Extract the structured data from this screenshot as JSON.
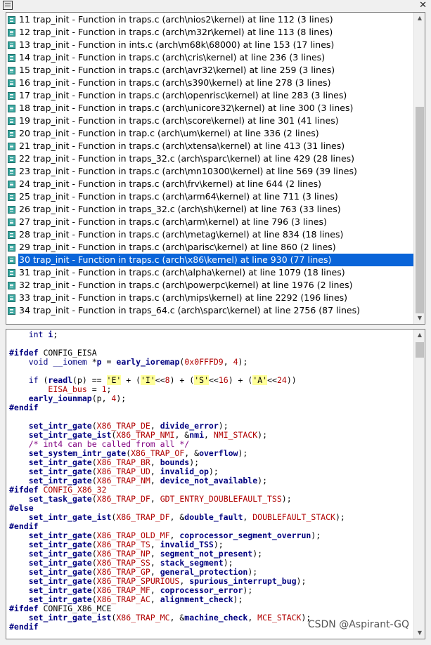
{
  "window": {
    "close_glyph": "✕"
  },
  "results": [
    {
      "label": "11 trap_init - Function in traps.c (arch\\nios2\\kernel) at line 112 (3 lines)"
    },
    {
      "label": "12 trap_init - Function in traps.c (arch\\m32r\\kernel) at line 113 (8 lines)"
    },
    {
      "label": "13 trap_init - Function in ints.c (arch\\m68k\\68000) at line 153 (17 lines)"
    },
    {
      "label": "14 trap_init - Function in traps.c (arch\\cris\\kernel) at line 236 (3 lines)"
    },
    {
      "label": "15 trap_init - Function in traps.c (arch\\avr32\\kernel) at line 259 (3 lines)"
    },
    {
      "label": "16 trap_init - Function in traps.c (arch\\s390\\kernel) at line 278 (3 lines)"
    },
    {
      "label": "17 trap_init - Function in traps.c (arch\\openrisc\\kernel) at line 283 (3 lines)"
    },
    {
      "label": "18 trap_init - Function in traps.c (arch\\unicore32\\kernel) at line 300 (3 lines)"
    },
    {
      "label": "19 trap_init - Function in traps.c (arch\\score\\kernel) at line 301 (41 lines)"
    },
    {
      "label": "20 trap_init - Function in trap.c (arch\\um\\kernel) at line 336 (2 lines)"
    },
    {
      "label": "21 trap_init - Function in traps.c (arch\\xtensa\\kernel) at line 413 (31 lines)"
    },
    {
      "label": "22 trap_init - Function in traps_32.c (arch\\sparc\\kernel) at line 429 (28 lines)"
    },
    {
      "label": "23 trap_init - Function in traps.c (arch\\mn10300\\kernel) at line 569 (39 lines)"
    },
    {
      "label": "24 trap_init - Function in traps.c (arch\\frv\\kernel) at line 644 (2 lines)"
    },
    {
      "label": "25 trap_init - Function in traps.c (arch\\arm64\\kernel) at line 711 (3 lines)"
    },
    {
      "label": "26 trap_init - Function in traps_32.c (arch\\sh\\kernel) at line 763 (33 lines)"
    },
    {
      "label": "27 trap_init - Function in traps.c (arch\\arm\\kernel) at line 796 (3 lines)"
    },
    {
      "label": "28 trap_init - Function in traps.c (arch\\metag\\kernel) at line 834 (18 lines)"
    },
    {
      "label": "29 trap_init - Function in traps.c (arch\\parisc\\kernel) at line 860 (2 lines)"
    },
    {
      "label": "30 trap_init - Function in traps.c (arch\\x86\\kernel) at line 930 (77 lines)",
      "selected": true
    },
    {
      "label": "31 trap_init - Function in traps.c (arch\\alpha\\kernel) at line 1079 (18 lines)"
    },
    {
      "label": "32 trap_init - Function in traps.c (arch\\powerpc\\kernel) at line 1976 (2 lines)"
    },
    {
      "label": "33 trap_init - Function in traps.c (arch\\mips\\kernel) at line 2292 (196 lines)"
    },
    {
      "label": "34 trap_init - Function in traps_64.c (arch\\sparc\\kernel) at line 2756 (87 lines)"
    }
  ],
  "code_lines": [
    [
      [
        "    ",
        ""
      ],
      [
        "int",
        "kw"
      ],
      [
        " ",
        ""
      ],
      [
        "i",
        "fn"
      ],
      [
        ";",
        ""
      ]
    ],
    [],
    [
      [
        "#ifdef",
        "pp"
      ],
      [
        " CONFIG_EISA",
        ""
      ]
    ],
    [
      [
        "    ",
        ""
      ],
      [
        "void",
        "kw"
      ],
      [
        " ",
        ""
      ],
      [
        "__iomem",
        "kw"
      ],
      [
        " *",
        ""
      ],
      [
        "p",
        "fn"
      ],
      [
        " = ",
        ""
      ],
      [
        "early_ioremap",
        "fn"
      ],
      [
        "(",
        ""
      ],
      [
        "0x0FFFD9",
        "num"
      ],
      [
        ", ",
        ""
      ],
      [
        "4",
        "num"
      ],
      [
        ");",
        ""
      ]
    ],
    [],
    [
      [
        "    ",
        ""
      ],
      [
        "if",
        "kw"
      ],
      [
        " (",
        ""
      ],
      [
        "readl",
        "fn"
      ],
      [
        "(p) == ",
        ""
      ],
      [
        "'E'",
        "str"
      ],
      [
        " + (",
        ""
      ],
      [
        "'I'",
        "str"
      ],
      [
        "<<",
        ""
      ],
      [
        "8",
        "num"
      ],
      [
        ") + (",
        ""
      ],
      [
        "'S'",
        "str"
      ],
      [
        "<<",
        ""
      ],
      [
        "16",
        "num"
      ],
      [
        ") + (",
        ""
      ],
      [
        "'A'",
        "str"
      ],
      [
        "<<",
        ""
      ],
      [
        "24",
        "num"
      ],
      [
        "))",
        ""
      ]
    ],
    [
      [
        "        ",
        ""
      ],
      [
        "EISA_bus",
        "mc"
      ],
      [
        " = ",
        ""
      ],
      [
        "1",
        "num"
      ],
      [
        ";",
        ""
      ]
    ],
    [
      [
        "    ",
        ""
      ],
      [
        "early_iounmap",
        "fn"
      ],
      [
        "(p, ",
        ""
      ],
      [
        "4",
        "num"
      ],
      [
        ");",
        ""
      ]
    ],
    [
      [
        "#endif",
        "pp"
      ]
    ],
    [],
    [
      [
        "    ",
        ""
      ],
      [
        "set_intr_gate",
        "fn"
      ],
      [
        "(",
        ""
      ],
      [
        "X86_TRAP_DE",
        "mc"
      ],
      [
        ", ",
        ""
      ],
      [
        "divide_error",
        "fn"
      ],
      [
        ");",
        ""
      ]
    ],
    [
      [
        "    ",
        ""
      ],
      [
        "set_intr_gate_ist",
        "fn"
      ],
      [
        "(",
        ""
      ],
      [
        "X86_TRAP_NMI",
        "mc"
      ],
      [
        ", &",
        ""
      ],
      [
        "nmi",
        "fn"
      ],
      [
        ", ",
        ""
      ],
      [
        "NMI_STACK",
        "mc"
      ],
      [
        ");",
        ""
      ]
    ],
    [
      [
        "    ",
        ""
      ],
      [
        "/* int4 can be called from all */",
        "cm"
      ]
    ],
    [
      [
        "    ",
        ""
      ],
      [
        "set_system_intr_gate",
        "fn"
      ],
      [
        "(",
        ""
      ],
      [
        "X86_TRAP_OF",
        "mc"
      ],
      [
        ", &",
        ""
      ],
      [
        "overflow",
        "fn"
      ],
      [
        ");",
        ""
      ]
    ],
    [
      [
        "    ",
        ""
      ],
      [
        "set_intr_gate",
        "fn"
      ],
      [
        "(",
        ""
      ],
      [
        "X86_TRAP_BR",
        "mc"
      ],
      [
        ", ",
        ""
      ],
      [
        "bounds",
        "fn"
      ],
      [
        ");",
        ""
      ]
    ],
    [
      [
        "    ",
        ""
      ],
      [
        "set_intr_gate",
        "fn"
      ],
      [
        "(",
        ""
      ],
      [
        "X86_TRAP_UD",
        "mc"
      ],
      [
        ", ",
        ""
      ],
      [
        "invalid_op",
        "fn"
      ],
      [
        ");",
        ""
      ]
    ],
    [
      [
        "    ",
        ""
      ],
      [
        "set_intr_gate",
        "fn"
      ],
      [
        "(",
        ""
      ],
      [
        "X86_TRAP_NM",
        "mc"
      ],
      [
        ", ",
        ""
      ],
      [
        "device_not_available",
        "fn"
      ],
      [
        ");",
        ""
      ]
    ],
    [
      [
        "#ifdef",
        "pp"
      ],
      [
        " ",
        ""
      ],
      [
        "CONFIG_X86_32",
        "mc"
      ]
    ],
    [
      [
        "    ",
        ""
      ],
      [
        "set_task_gate",
        "fn"
      ],
      [
        "(",
        ""
      ],
      [
        "X86_TRAP_DF",
        "mc"
      ],
      [
        ", ",
        ""
      ],
      [
        "GDT_ENTRY_DOUBLEFAULT_TSS",
        "mc"
      ],
      [
        ");",
        ""
      ]
    ],
    [
      [
        "#else",
        "pp"
      ]
    ],
    [
      [
        "    ",
        ""
      ],
      [
        "set_intr_gate_ist",
        "fn"
      ],
      [
        "(",
        ""
      ],
      [
        "X86_TRAP_DF",
        "mc"
      ],
      [
        ", &",
        ""
      ],
      [
        "double_fault",
        "fn"
      ],
      [
        ", ",
        ""
      ],
      [
        "DOUBLEFAULT_STACK",
        "mc"
      ],
      [
        ");",
        ""
      ]
    ],
    [
      [
        "#endif",
        "pp"
      ]
    ],
    [
      [
        "    ",
        ""
      ],
      [
        "set_intr_gate",
        "fn"
      ],
      [
        "(",
        ""
      ],
      [
        "X86_TRAP_OLD_MF",
        "mc"
      ],
      [
        ", ",
        ""
      ],
      [
        "coprocessor_segment_overrun",
        "fn"
      ],
      [
        ");",
        ""
      ]
    ],
    [
      [
        "    ",
        ""
      ],
      [
        "set_intr_gate",
        "fn"
      ],
      [
        "(",
        ""
      ],
      [
        "X86_TRAP_TS",
        "mc"
      ],
      [
        ", ",
        ""
      ],
      [
        "invalid_TSS",
        "fn"
      ],
      [
        ");",
        ""
      ]
    ],
    [
      [
        "    ",
        ""
      ],
      [
        "set_intr_gate",
        "fn"
      ],
      [
        "(",
        ""
      ],
      [
        "X86_TRAP_NP",
        "mc"
      ],
      [
        ", ",
        ""
      ],
      [
        "segment_not_present",
        "fn"
      ],
      [
        ");",
        ""
      ]
    ],
    [
      [
        "    ",
        ""
      ],
      [
        "set_intr_gate",
        "fn"
      ],
      [
        "(",
        ""
      ],
      [
        "X86_TRAP_SS",
        "mc"
      ],
      [
        ", ",
        ""
      ],
      [
        "stack_segment",
        "fn"
      ],
      [
        ");",
        ""
      ]
    ],
    [
      [
        "    ",
        ""
      ],
      [
        "set_intr_gate",
        "fn"
      ],
      [
        "(",
        ""
      ],
      [
        "X86_TRAP_GP",
        "mc"
      ],
      [
        ", ",
        ""
      ],
      [
        "general_protection",
        "fn"
      ],
      [
        ");",
        ""
      ]
    ],
    [
      [
        "    ",
        ""
      ],
      [
        "set_intr_gate",
        "fn"
      ],
      [
        "(",
        ""
      ],
      [
        "X86_TRAP_SPURIOUS",
        "mc"
      ],
      [
        ", ",
        ""
      ],
      [
        "spurious_interrupt_bug",
        "fn"
      ],
      [
        ");",
        ""
      ]
    ],
    [
      [
        "    ",
        ""
      ],
      [
        "set_intr_gate",
        "fn"
      ],
      [
        "(",
        ""
      ],
      [
        "X86_TRAP_MF",
        "mc"
      ],
      [
        ", ",
        ""
      ],
      [
        "coprocessor_error",
        "fn"
      ],
      [
        ");",
        ""
      ]
    ],
    [
      [
        "    ",
        ""
      ],
      [
        "set_intr_gate",
        "fn"
      ],
      [
        "(",
        ""
      ],
      [
        "X86_TRAP_AC",
        "mc"
      ],
      [
        ", ",
        ""
      ],
      [
        "alignment_check",
        "fn"
      ],
      [
        ");",
        ""
      ]
    ],
    [
      [
        "#ifdef",
        "pp"
      ],
      [
        " CONFIG_X86_MCE",
        ""
      ]
    ],
    [
      [
        "    ",
        ""
      ],
      [
        "set_intr_gate_ist",
        "fn"
      ],
      [
        "(",
        ""
      ],
      [
        "X86_TRAP_MC",
        "mc"
      ],
      [
        ", &",
        ""
      ],
      [
        "machine_check",
        "fn"
      ],
      [
        ", ",
        ""
      ],
      [
        "MCE_STACK",
        "mc"
      ],
      [
        ");",
        ""
      ]
    ],
    [
      [
        "#endif",
        "pp"
      ]
    ]
  ],
  "watermark": "CSDN @Aspirant-GQ",
  "colors": {
    "selection": "#0a64d8",
    "keyword": "#000080",
    "macro": "#b00000",
    "comment": "#800080",
    "char_highlight": "#ffff99"
  },
  "icons": {
    "app": "source-insight-icon",
    "result": "function-symbol-icon"
  }
}
